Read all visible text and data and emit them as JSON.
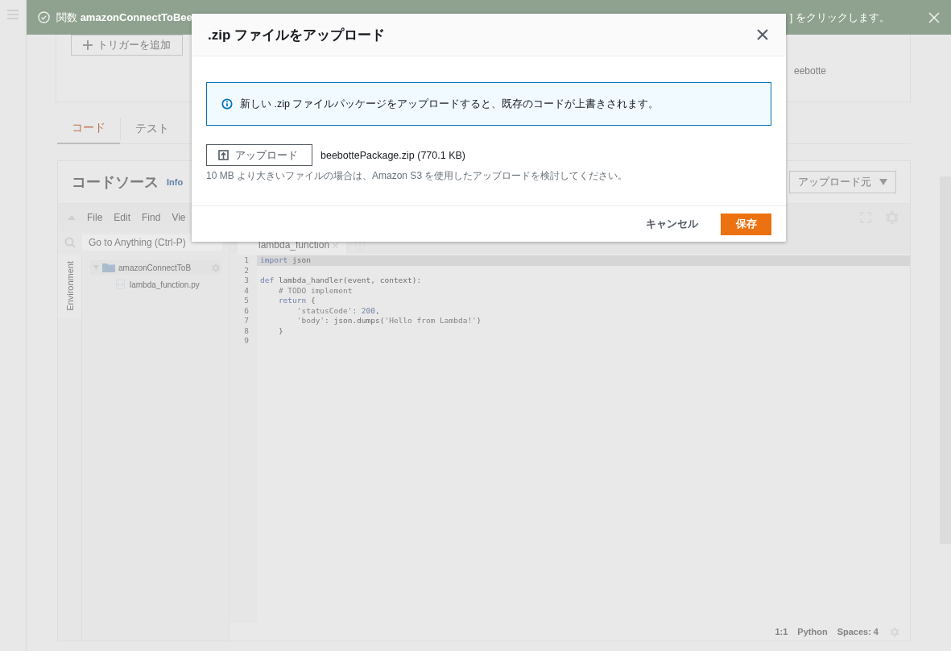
{
  "banner": {
    "text_start": "関数 **amazonConnectToBee**",
    "text_end": "] をクリックします。"
  },
  "triggers_card": {
    "add_trigger_button": "トリガーを追加",
    "destination": "eebotte"
  },
  "tabs": [
    {
      "label": "コード",
      "selected": true
    },
    {
      "label": "テスト",
      "selected": false
    }
  ],
  "code_source": {
    "title": "コードソース",
    "info_link": "Info",
    "upload_from_button": "アップロード元",
    "ide": {
      "menu": [
        "File",
        "Edit",
        "Find",
        "Vie"
      ],
      "search_placeholder": "Go to Anything (Ctrl-P)",
      "environment_tab": "Environment",
      "tree": [
        {
          "label": "amazonConnectToB",
          "kind": "folder",
          "expanded": true,
          "children": [
            {
              "label": "lambda_function.py",
              "kind": "file"
            }
          ]
        }
      ],
      "editor_tab": "lambda_function",
      "code": [
        {
          "number": "1",
          "active": true,
          "tokens": [
            {
              "kind": "keyword",
              "text": "import"
            },
            {
              "kind": "plain",
              "text": " json"
            }
          ]
        },
        {
          "number": "2",
          "active": false
        },
        {
          "number": "3",
          "active": false,
          "tokens": [
            {
              "kind": "keyword",
              "text": "def"
            },
            {
              "kind": "plain",
              "text": " lambda_handler(event, context):"
            }
          ]
        },
        {
          "number": "4",
          "active": false,
          "tokens": [
            {
              "kind": "comment",
              "text": "    # TODO implement"
            }
          ]
        },
        {
          "number": "5",
          "active": false,
          "tokens": [
            {
              "kind": "keyword",
              "text": "    return"
            },
            {
              "kind": "plain",
              "text": " {"
            }
          ]
        },
        {
          "number": "6",
          "active": false,
          "tokens": [
            {
              "kind": "string",
              "text": "        'statusCode'"
            },
            {
              "kind": "plain",
              "text": ": "
            },
            {
              "kind": "number",
              "text": "200"
            },
            {
              "kind": "plain",
              "text": ","
            }
          ]
        },
        {
          "number": "7",
          "active": false,
          "tokens": [
            {
              "kind": "string",
              "text": "        'body'"
            },
            {
              "kind": "plain",
              "text": ": json.dumps("
            },
            {
              "kind": "string",
              "text": "'Hello from Lambda!'"
            },
            {
              "kind": "plain",
              "text": ")"
            }
          ]
        },
        {
          "number": "8",
          "active": false,
          "tokens": [
            {
              "kind": "plain",
              "text": "    }"
            }
          ]
        },
        {
          "number": "9",
          "active": false
        }
      ],
      "status": {
        "position": "1:1",
        "language": "Python",
        "indent": "Spaces: 4"
      }
    }
  },
  "modal": {
    "title": ".zip ファイルをアップロード",
    "info": "新しい .zip ファイルパッケージをアップロードすると、既存のコードが上書きされます。",
    "upload_button": "アップロード",
    "file_name": "beebottePackage.zip (770.1 KB)",
    "hint": "10 MB より大きいファイルの場合は、Amazon S3 を使用したアップロードを検討してください。",
    "buttons": [
      {
        "label": "キャンセル",
        "kind": "secondary"
      },
      {
        "label": "保存",
        "kind": "primary"
      }
    ]
  }
}
